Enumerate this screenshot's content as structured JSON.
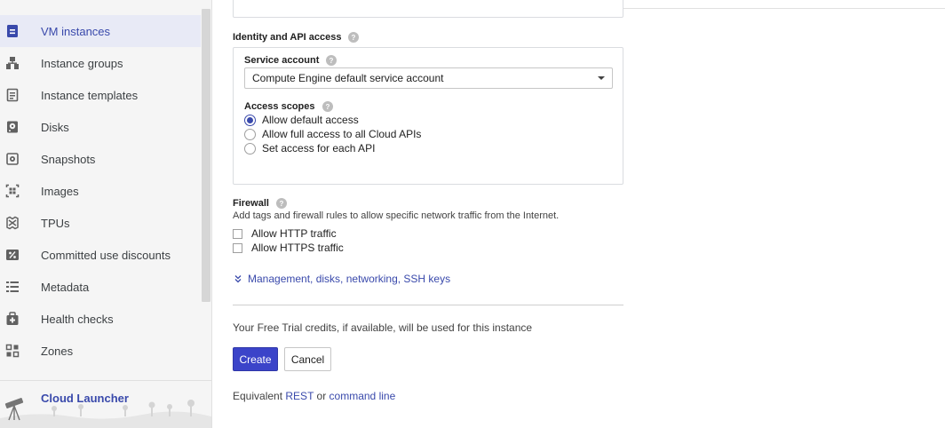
{
  "sidebar": {
    "items": [
      {
        "label": "VM instances",
        "icon": "vm-instances-icon",
        "active": true
      },
      {
        "label": "Instance groups",
        "icon": "instance-groups-icon"
      },
      {
        "label": "Instance templates",
        "icon": "instance-templates-icon"
      },
      {
        "label": "Disks",
        "icon": "disk-icon"
      },
      {
        "label": "Snapshots",
        "icon": "snapshot-icon"
      },
      {
        "label": "Images",
        "icon": "images-icon"
      },
      {
        "label": "TPUs",
        "icon": "tpu-icon"
      },
      {
        "label": "Committed use discounts",
        "icon": "percent-icon"
      },
      {
        "label": "Metadata",
        "icon": "metadata-list-icon"
      },
      {
        "label": "Health checks",
        "icon": "health-check-icon"
      },
      {
        "label": "Zones",
        "icon": "zones-icon"
      }
    ],
    "launcher": {
      "label": "Cloud Launcher",
      "icon": "telescope-icon"
    }
  },
  "identity": {
    "title": "Identity and API access",
    "service_account": {
      "label": "Service account",
      "value": "Compute Engine default service account"
    },
    "access_scopes": {
      "label": "Access scopes",
      "options": [
        {
          "label": "Allow default access",
          "selected": true
        },
        {
          "label": "Allow full access to all Cloud APIs",
          "selected": false
        },
        {
          "label": "Set access for each API",
          "selected": false
        }
      ]
    }
  },
  "firewall": {
    "title": "Firewall",
    "description": "Add tags and firewall rules to allow specific network traffic from the Internet.",
    "options": [
      {
        "label": "Allow HTTP traffic",
        "checked": false
      },
      {
        "label": "Allow HTTPS traffic",
        "checked": false
      }
    ]
  },
  "expand_link": "Management, disks, networking, SSH keys",
  "trial_note": "Your Free Trial credits, if available, will be used for this instance",
  "actions": {
    "create": "Create",
    "cancel": "Cancel"
  },
  "equivalent": {
    "prefix": "Equivalent",
    "rest": "REST",
    "or": "or",
    "command_line": "command line"
  },
  "colors": {
    "accent": "#3949ab",
    "primary_button": "#3b44c9",
    "active_nav_bg": "#e8eaf6"
  }
}
